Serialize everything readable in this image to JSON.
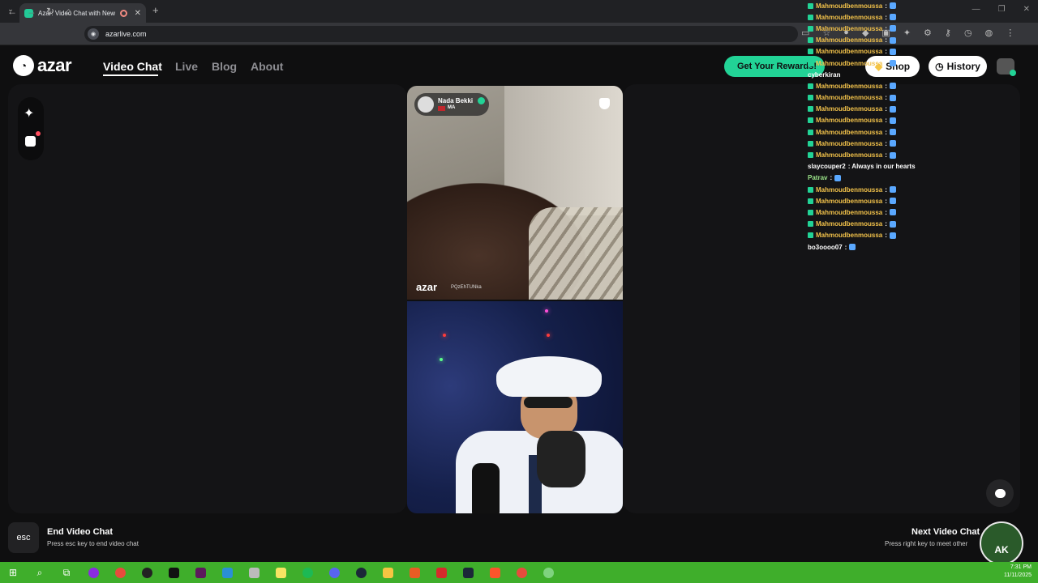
{
  "browser": {
    "tab_title": "Azar: Video Chat with New",
    "url": "azarlive.com"
  },
  "header": {
    "logo_text": "azar",
    "nav": [
      "Video Chat",
      "Live",
      "Blog",
      "About"
    ],
    "rewards_label": "Get Your Rewards!",
    "shop_label": "Shop",
    "history_label": "History"
  },
  "partner": {
    "name": "Nada Bekki",
    "country": "MA",
    "watermark": "azar",
    "watermark_id": "PQzEhTUNka"
  },
  "chat_overlay": [
    {
      "user": "Mahmoudbenmoussa",
      "msg": ":"
    },
    {
      "user": "Mahmoudbenmoussa",
      "msg": ":"
    },
    {
      "user": "Mahmoudbenmoussa",
      "msg": ":"
    },
    {
      "user": "Mahmoudbenmoussa",
      "msg": ":"
    },
    {
      "user": "Mahmoudbenmoussa",
      "msg": ":"
    },
    {
      "user": "Mahmoudbenmoussa",
      "msg": ":"
    },
    {
      "user": "cyberkiran",
      "msg": ""
    },
    {
      "user": "Mahmoudbenmoussa",
      "msg": ":"
    },
    {
      "user": "Mahmoudbenmoussa",
      "msg": ":"
    },
    {
      "user": "Mahmoudbenmoussa",
      "msg": ":"
    },
    {
      "user": "Mahmoudbenmoussa",
      "msg": ":"
    },
    {
      "user": "Mahmoudbenmoussa",
      "msg": ":"
    },
    {
      "user": "Mahmoudbenmoussa",
      "msg": ":"
    },
    {
      "user": "Mahmoudbenmoussa",
      "msg": ":"
    },
    {
      "user": "slaycouper2",
      "msg": ": Always in our hearts"
    },
    {
      "user": "Patrav",
      "msg": ":"
    },
    {
      "user": "Mahmoudbenmoussa",
      "msg": ":"
    },
    {
      "user": "Mahmoudbenmoussa",
      "msg": ":"
    },
    {
      "user": "Mahmoudbenmoussa",
      "msg": ":"
    },
    {
      "user": "Mahmoudbenmoussa",
      "msg": ":"
    },
    {
      "user": "Mahmoudbenmoussa",
      "msg": ":"
    },
    {
      "user": "bo3oooo07",
      "msg": ":"
    }
  ],
  "controls": {
    "esc_key": "esc",
    "end_title": "End Video Chat",
    "end_sub": "Press esc key to end video chat",
    "next_title": "Next Video Chat",
    "next_sub": "Press right key to meet other"
  },
  "stream_logo": "AK",
  "taskbar": {
    "time": "7:31 PM",
    "date": "11/11/2025"
  },
  "colors": {
    "accent": "#22d396",
    "taskbar": "#3fae2b",
    "background": "#0f0f10"
  }
}
